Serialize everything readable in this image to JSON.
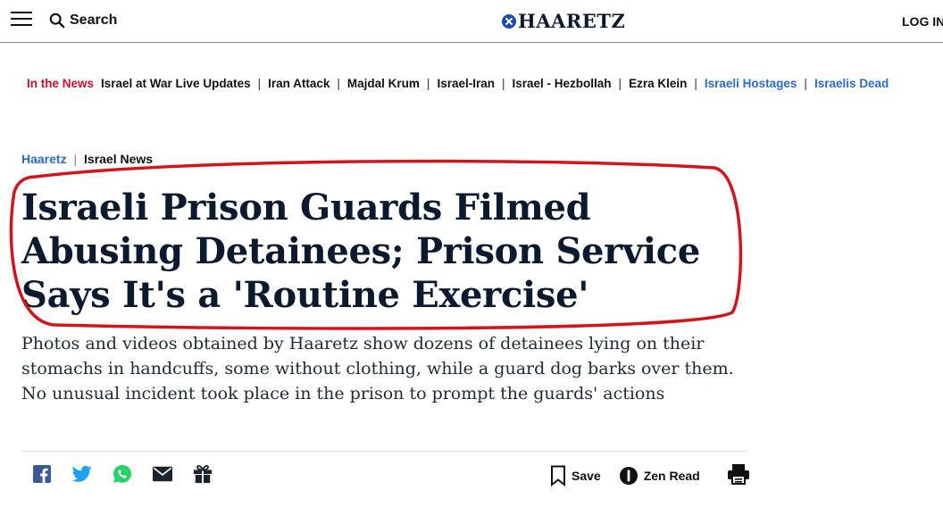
{
  "header": {
    "search_label": "Search",
    "logo_text": "HAARETZ",
    "login_label": "LOG IN"
  },
  "news_bar": {
    "label": "In the News",
    "items": [
      {
        "text": "Israel at War Live Updates"
      },
      {
        "text": "Iran Attack"
      },
      {
        "text": "Majdal Krum"
      },
      {
        "text": "Israel-Iran"
      },
      {
        "text": "Israel - Hezbollah"
      },
      {
        "text": "Ezra Klein"
      },
      {
        "text": "Israeli Hostages"
      },
      {
        "text": "Israelis Dead"
      }
    ],
    "separator": "|"
  },
  "breadcrumb": {
    "home": "Haaretz",
    "separator": "|",
    "section": "Israel News"
  },
  "article": {
    "headline": "Israeli Prison Guards Filmed Abusing Detainees; Prison Service Says It's a 'Routine Exercise'",
    "subtitle": "Photos and videos obtained by Haaretz show dozens of detainees lying on their stomachs in handcuffs, some without clothing, while a guard dog barks over them. No unusual incident took place in the prison to prompt the guards' actions"
  },
  "share_icons": [
    "facebook-icon",
    "twitter-icon",
    "whatsapp-icon",
    "email-icon",
    "gift-icon"
  ],
  "actions": {
    "save_label": "Save",
    "zen_read_label": "Zen Read"
  },
  "colors": {
    "accent_red": "#c8102e",
    "link_blue": "#2a6bd0",
    "logo_blue": "#1c4fa1",
    "facebook": "#3b5998",
    "twitter": "#1da1f2",
    "whatsapp": "#25d366",
    "annotation_red": "#d4141c"
  }
}
